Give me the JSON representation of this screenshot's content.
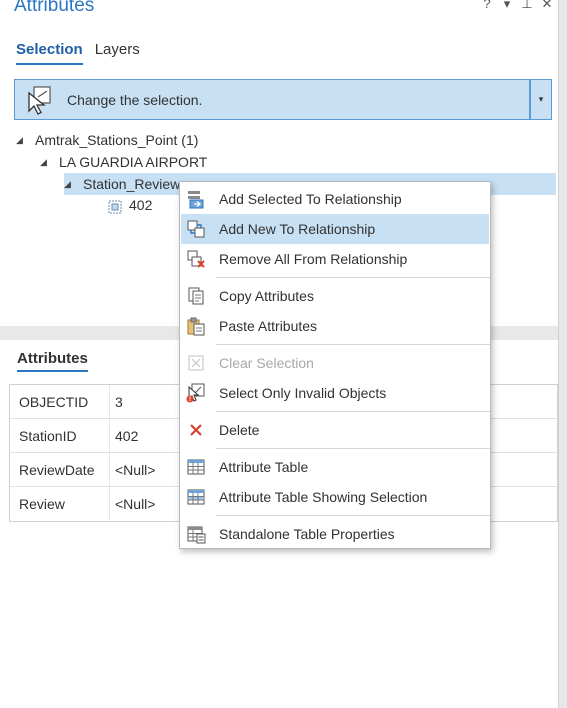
{
  "pane": {
    "title": "Attributes",
    "tools": [
      "?",
      "▾",
      "⊥",
      "✕"
    ]
  },
  "tabs": [
    {
      "label": "Selection",
      "active": true
    },
    {
      "label": "Layers",
      "active": false
    }
  ],
  "change_selection": {
    "label": "Change the selection.",
    "dropdown_glyph": "▾"
  },
  "tree": {
    "layer": "Amtrak_Stations_Point  (1)",
    "feature": "LA GUARDIA AIRPORT",
    "related": "Station_Review",
    "record": "402"
  },
  "attributes_tab": "Attributes",
  "attributes": [
    {
      "key": "OBJECTID",
      "value": "3"
    },
    {
      "key": "StationID",
      "value": "402"
    },
    {
      "key": "ReviewDate",
      "value": "<Null>"
    },
    {
      "key": "Review",
      "value": "<Null>"
    }
  ],
  "context_menu": {
    "items": [
      {
        "label": "Add Selected To Relationship",
        "icon": "add-selected-icon"
      },
      {
        "label": "Add New To Relationship",
        "icon": "add-new-icon",
        "hover": true
      },
      {
        "label": "Remove All From Relationship",
        "icon": "remove-all-icon"
      },
      {
        "label": "Copy Attributes",
        "icon": "copy-icon"
      },
      {
        "label": "Paste Attributes",
        "icon": "paste-icon"
      },
      {
        "label": "Clear Selection",
        "icon": "clear-selection-icon",
        "disabled": true
      },
      {
        "label": "Select Only Invalid Objects",
        "icon": "invalid-objects-icon"
      },
      {
        "label": "Delete",
        "icon": "delete-icon"
      },
      {
        "label": "Attribute Table",
        "icon": "table-icon"
      },
      {
        "label": "Attribute Table Showing Selection",
        "icon": "table-selection-icon"
      },
      {
        "label": "Standalone Table Properties",
        "icon": "table-properties-icon"
      }
    ]
  },
  "colors": {
    "accent": "#2a76c4",
    "selection": "#c7e0f4",
    "delete": "#d9412b"
  }
}
